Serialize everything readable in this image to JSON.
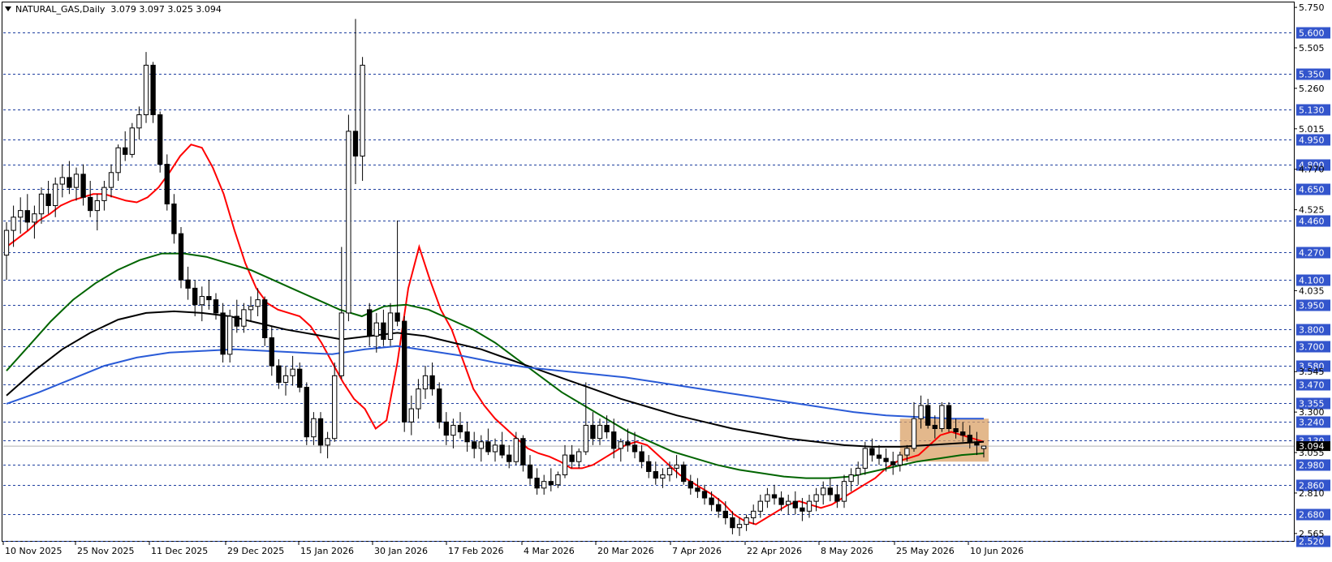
{
  "header": {
    "symbol_timeframe": "NATURAL_GAS,Daily",
    "ohlc": "3.079 3.097 3.025 3.094"
  },
  "colors": {
    "level_line": "#1f3f9f",
    "level_label_bg": "#3355cc",
    "ma_red": "#ff0000",
    "ma_green": "#006400",
    "ma_black": "#000000",
    "ma_blue": "#2a5bd7",
    "candle_bull": "#ffffff",
    "candle_bear": "#000000",
    "highlight_box": "#d9a066"
  },
  "price_axis": {
    "ticks": [
      "5.750",
      "5.505",
      "5.260",
      "5.015",
      "4.770",
      "4.525",
      "4.035",
      "3.545",
      "3.300",
      "3.055",
      "2.810",
      "2.565"
    ],
    "current_price": "3.094"
  },
  "levels": [
    "5.600",
    "5.350",
    "5.130",
    "4.950",
    "4.800",
    "4.650",
    "4.460",
    "4.270",
    "4.100",
    "3.950",
    "3.800",
    "3.700",
    "3.580",
    "3.470",
    "3.355",
    "3.240",
    "3.130",
    "2.980",
    "2.860",
    "2.680",
    "2.520"
  ],
  "time_axis": [
    "10 Nov 2025",
    "25 Nov 2025",
    "11 Dec 2025",
    "29 Dec 2025",
    "15 Jan 2026",
    "30 Jan 2026",
    "17 Feb 2026",
    "4 Mar 2026",
    "20 Mar 2026",
    "7 Apr 2026",
    "22 Apr 2026",
    "8 May 2026",
    "25 May 2026",
    "10 Jun 2026"
  ],
  "highlight_zone": {
    "from": "25 May 2026",
    "to": "10 Jun 2026",
    "high": 3.26,
    "low": 3.0
  },
  "chart_data": {
    "type": "candlestick",
    "price_min": 2.52,
    "price_max": 5.78,
    "candles": [
      {
        "o": 4.25,
        "h": 4.45,
        "l": 4.1,
        "c": 4.4
      },
      {
        "o": 4.4,
        "h": 4.55,
        "l": 4.3,
        "c": 4.48
      },
      {
        "o": 4.48,
        "h": 4.6,
        "l": 4.38,
        "c": 4.52
      },
      {
        "o": 4.52,
        "h": 4.62,
        "l": 4.4,
        "c": 4.45
      },
      {
        "o": 4.45,
        "h": 4.55,
        "l": 4.35,
        "c": 4.5
      },
      {
        "o": 4.5,
        "h": 4.66,
        "l": 4.44,
        "c": 4.62
      },
      {
        "o": 4.62,
        "h": 4.7,
        "l": 4.5,
        "c": 4.55
      },
      {
        "o": 4.55,
        "h": 4.72,
        "l": 4.48,
        "c": 4.68
      },
      {
        "o": 4.68,
        "h": 4.8,
        "l": 4.6,
        "c": 4.72
      },
      {
        "o": 4.72,
        "h": 4.82,
        "l": 4.62,
        "c": 4.66
      },
      {
        "o": 4.66,
        "h": 4.78,
        "l": 4.58,
        "c": 4.74
      },
      {
        "o": 4.74,
        "h": 4.8,
        "l": 4.55,
        "c": 4.6
      },
      {
        "o": 4.6,
        "h": 4.7,
        "l": 4.48,
        "c": 4.52
      },
      {
        "o": 4.52,
        "h": 4.62,
        "l": 4.4,
        "c": 4.58
      },
      {
        "o": 4.58,
        "h": 4.7,
        "l": 4.52,
        "c": 4.66
      },
      {
        "o": 4.66,
        "h": 4.8,
        "l": 4.6,
        "c": 4.75
      },
      {
        "o": 4.75,
        "h": 4.92,
        "l": 4.7,
        "c": 4.9
      },
      {
        "o": 4.9,
        "h": 5.0,
        "l": 4.82,
        "c": 4.86
      },
      {
        "o": 4.86,
        "h": 5.05,
        "l": 4.84,
        "c": 5.02
      },
      {
        "o": 5.02,
        "h": 5.15,
        "l": 4.95,
        "c": 5.1
      },
      {
        "o": 5.1,
        "h": 5.48,
        "l": 5.05,
        "c": 5.4
      },
      {
        "o": 5.4,
        "h": 5.42,
        "l": 5.05,
        "c": 5.1
      },
      {
        "o": 5.1,
        "h": 5.12,
        "l": 4.75,
        "c": 4.8
      },
      {
        "o": 4.8,
        "h": 4.86,
        "l": 4.52,
        "c": 4.56
      },
      {
        "o": 4.56,
        "h": 4.62,
        "l": 4.32,
        "c": 4.38
      },
      {
        "o": 4.38,
        "h": 4.42,
        "l": 4.05,
        "c": 4.1
      },
      {
        "o": 4.1,
        "h": 4.18,
        "l": 3.98,
        "c": 4.05
      },
      {
        "o": 4.05,
        "h": 4.1,
        "l": 3.88,
        "c": 3.95
      },
      {
        "o": 3.95,
        "h": 4.06,
        "l": 3.85,
        "c": 4.0
      },
      {
        "o": 4.0,
        "h": 4.1,
        "l": 3.92,
        "c": 3.98
      },
      {
        "o": 3.98,
        "h": 4.02,
        "l": 3.86,
        "c": 3.9
      },
      {
        "o": 3.9,
        "h": 3.96,
        "l": 3.6,
        "c": 3.65
      },
      {
        "o": 3.65,
        "h": 3.92,
        "l": 3.6,
        "c": 3.88
      },
      {
        "o": 3.88,
        "h": 3.98,
        "l": 3.78,
        "c": 3.82
      },
      {
        "o": 3.82,
        "h": 3.96,
        "l": 3.78,
        "c": 3.92
      },
      {
        "o": 3.92,
        "h": 4.0,
        "l": 3.85,
        "c": 3.94
      },
      {
        "o": 3.94,
        "h": 4.05,
        "l": 3.88,
        "c": 3.98
      },
      {
        "o": 3.98,
        "h": 4.0,
        "l": 3.7,
        "c": 3.75
      },
      {
        "o": 3.75,
        "h": 3.82,
        "l": 3.52,
        "c": 3.58
      },
      {
        "o": 3.58,
        "h": 3.62,
        "l": 3.44,
        "c": 3.48
      },
      {
        "o": 3.48,
        "h": 3.58,
        "l": 3.4,
        "c": 3.52
      },
      {
        "o": 3.52,
        "h": 3.64,
        "l": 3.46,
        "c": 3.56
      },
      {
        "o": 3.56,
        "h": 3.6,
        "l": 3.42,
        "c": 3.45
      },
      {
        "o": 3.45,
        "h": 3.48,
        "l": 3.1,
        "c": 3.15
      },
      {
        "o": 3.15,
        "h": 3.3,
        "l": 3.1,
        "c": 3.26
      },
      {
        "o": 3.26,
        "h": 3.3,
        "l": 3.05,
        "c": 3.1
      },
      {
        "o": 3.1,
        "h": 3.18,
        "l": 3.02,
        "c": 3.14
      },
      {
        "o": 3.14,
        "h": 3.6,
        "l": 3.12,
        "c": 3.52
      },
      {
        "o": 3.52,
        "h": 4.3,
        "l": 3.5,
        "c": 3.9
      },
      {
        "o": 3.9,
        "h": 5.1,
        "l": 3.85,
        "c": 5.0
      },
      {
        "o": 5.0,
        "h": 5.68,
        "l": 4.68,
        "c": 4.85
      },
      {
        "o": 4.85,
        "h": 5.45,
        "l": 4.7,
        "c": 5.4
      },
      {
        "o": 3.92,
        "h": 3.96,
        "l": 3.7,
        "c": 3.76
      },
      {
        "o": 3.76,
        "h": 3.9,
        "l": 3.66,
        "c": 3.84
      },
      {
        "o": 3.84,
        "h": 3.92,
        "l": 3.7,
        "c": 3.74
      },
      {
        "o": 3.74,
        "h": 3.96,
        "l": 3.7,
        "c": 3.9
      },
      {
        "o": 3.9,
        "h": 4.46,
        "l": 3.82,
        "c": 3.85
      },
      {
        "o": 3.85,
        "h": 3.88,
        "l": 3.18,
        "c": 3.24
      },
      {
        "o": 3.24,
        "h": 3.4,
        "l": 3.16,
        "c": 3.32
      },
      {
        "o": 3.32,
        "h": 3.5,
        "l": 3.26,
        "c": 3.44
      },
      {
        "o": 3.44,
        "h": 3.58,
        "l": 3.38,
        "c": 3.52
      },
      {
        "o": 3.52,
        "h": 3.6,
        "l": 3.4,
        "c": 3.44
      },
      {
        "o": 3.44,
        "h": 3.48,
        "l": 3.2,
        "c": 3.24
      },
      {
        "o": 3.24,
        "h": 3.3,
        "l": 3.1,
        "c": 3.16
      },
      {
        "o": 3.16,
        "h": 3.26,
        "l": 3.08,
        "c": 3.22
      },
      {
        "o": 3.22,
        "h": 3.3,
        "l": 3.14,
        "c": 3.18
      },
      {
        "o": 3.18,
        "h": 3.24,
        "l": 3.06,
        "c": 3.12
      },
      {
        "o": 3.12,
        "h": 3.18,
        "l": 3.02,
        "c": 3.08
      },
      {
        "o": 3.08,
        "h": 3.16,
        "l": 3.0,
        "c": 3.12
      },
      {
        "o": 3.12,
        "h": 3.2,
        "l": 3.04,
        "c": 3.06
      },
      {
        "o": 3.06,
        "h": 3.14,
        "l": 3.0,
        "c": 3.1
      },
      {
        "o": 3.1,
        "h": 3.18,
        "l": 3.02,
        "c": 3.04
      },
      {
        "o": 3.04,
        "h": 3.1,
        "l": 2.96,
        "c": 3.0
      },
      {
        "o": 3.0,
        "h": 3.18,
        "l": 2.98,
        "c": 3.14
      },
      {
        "o": 3.14,
        "h": 3.16,
        "l": 2.94,
        "c": 2.98
      },
      {
        "o": 2.98,
        "h": 3.04,
        "l": 2.86,
        "c": 2.9
      },
      {
        "o": 2.9,
        "h": 2.96,
        "l": 2.8,
        "c": 2.84
      },
      {
        "o": 2.84,
        "h": 2.92,
        "l": 2.8,
        "c": 2.88
      },
      {
        "o": 2.88,
        "h": 2.96,
        "l": 2.82,
        "c": 2.86
      },
      {
        "o": 2.86,
        "h": 2.94,
        "l": 2.84,
        "c": 2.92
      },
      {
        "o": 2.92,
        "h": 3.1,
        "l": 2.9,
        "c": 3.04
      },
      {
        "o": 3.04,
        "h": 3.1,
        "l": 2.96,
        "c": 3.0
      },
      {
        "o": 3.0,
        "h": 3.08,
        "l": 2.96,
        "c": 3.06
      },
      {
        "o": 3.06,
        "h": 3.48,
        "l": 3.04,
        "c": 3.22
      },
      {
        "o": 3.22,
        "h": 3.3,
        "l": 3.1,
        "c": 3.14
      },
      {
        "o": 3.14,
        "h": 3.26,
        "l": 3.1,
        "c": 3.22
      },
      {
        "o": 3.22,
        "h": 3.28,
        "l": 3.14,
        "c": 3.18
      },
      {
        "o": 3.18,
        "h": 3.26,
        "l": 3.02,
        "c": 3.08
      },
      {
        "o": 3.08,
        "h": 3.14,
        "l": 3.0,
        "c": 3.12
      },
      {
        "o": 3.12,
        "h": 3.2,
        "l": 3.06,
        "c": 3.1
      },
      {
        "o": 3.1,
        "h": 3.18,
        "l": 3.02,
        "c": 3.06
      },
      {
        "o": 3.06,
        "h": 3.1,
        "l": 2.96,
        "c": 3.0
      },
      {
        "o": 3.0,
        "h": 3.04,
        "l": 2.9,
        "c": 2.94
      },
      {
        "o": 2.94,
        "h": 3.0,
        "l": 2.86,
        "c": 2.9
      },
      {
        "o": 2.9,
        "h": 2.96,
        "l": 2.84,
        "c": 2.92
      },
      {
        "o": 2.92,
        "h": 3.0,
        "l": 2.88,
        "c": 2.96
      },
      {
        "o": 2.96,
        "h": 3.04,
        "l": 2.9,
        "c": 2.98
      },
      {
        "o": 2.98,
        "h": 3.0,
        "l": 2.86,
        "c": 2.88
      },
      {
        "o": 2.88,
        "h": 2.92,
        "l": 2.8,
        "c": 2.84
      },
      {
        "o": 2.84,
        "h": 2.9,
        "l": 2.78,
        "c": 2.82
      },
      {
        "o": 2.82,
        "h": 2.86,
        "l": 2.74,
        "c": 2.78
      },
      {
        "o": 2.78,
        "h": 2.82,
        "l": 2.7,
        "c": 2.74
      },
      {
        "o": 2.74,
        "h": 2.78,
        "l": 2.66,
        "c": 2.7
      },
      {
        "o": 2.7,
        "h": 2.76,
        "l": 2.62,
        "c": 2.66
      },
      {
        "o": 2.66,
        "h": 2.7,
        "l": 2.56,
        "c": 2.6
      },
      {
        "o": 2.6,
        "h": 2.66,
        "l": 2.55,
        "c": 2.62
      },
      {
        "o": 2.62,
        "h": 2.68,
        "l": 2.58,
        "c": 2.66
      },
      {
        "o": 2.66,
        "h": 2.74,
        "l": 2.62,
        "c": 2.7
      },
      {
        "o": 2.7,
        "h": 2.8,
        "l": 2.66,
        "c": 2.76
      },
      {
        "o": 2.76,
        "h": 2.84,
        "l": 2.72,
        "c": 2.8
      },
      {
        "o": 2.8,
        "h": 2.86,
        "l": 2.74,
        "c": 2.78
      },
      {
        "o": 2.78,
        "h": 2.82,
        "l": 2.7,
        "c": 2.74
      },
      {
        "o": 2.74,
        "h": 2.8,
        "l": 2.68,
        "c": 2.76
      },
      {
        "o": 2.76,
        "h": 2.82,
        "l": 2.68,
        "c": 2.72
      },
      {
        "o": 2.72,
        "h": 2.78,
        "l": 2.64,
        "c": 2.7
      },
      {
        "o": 2.7,
        "h": 2.8,
        "l": 2.66,
        "c": 2.76
      },
      {
        "o": 2.76,
        "h": 2.84,
        "l": 2.7,
        "c": 2.8
      },
      {
        "o": 2.8,
        "h": 2.88,
        "l": 2.74,
        "c": 2.84
      },
      {
        "o": 2.84,
        "h": 2.9,
        "l": 2.76,
        "c": 2.8
      },
      {
        "o": 2.8,
        "h": 2.86,
        "l": 2.72,
        "c": 2.76
      },
      {
        "o": 2.76,
        "h": 2.92,
        "l": 2.72,
        "c": 2.88
      },
      {
        "o": 2.88,
        "h": 2.96,
        "l": 2.82,
        "c": 2.92
      },
      {
        "o": 2.92,
        "h": 3.0,
        "l": 2.86,
        "c": 2.96
      },
      {
        "o": 2.96,
        "h": 3.12,
        "l": 2.92,
        "c": 3.08
      },
      {
        "o": 3.08,
        "h": 3.14,
        "l": 3.0,
        "c": 3.04
      },
      {
        "o": 3.04,
        "h": 3.1,
        "l": 2.98,
        "c": 3.02
      },
      {
        "o": 3.02,
        "h": 3.08,
        "l": 2.94,
        "c": 3.0
      },
      {
        "o": 3.0,
        "h": 3.06,
        "l": 2.92,
        "c": 2.98
      },
      {
        "o": 2.98,
        "h": 3.06,
        "l": 2.94,
        "c": 3.04
      },
      {
        "o": 3.04,
        "h": 3.1,
        "l": 3.0,
        "c": 3.08
      },
      {
        "o": 3.08,
        "h": 3.36,
        "l": 3.06,
        "c": 3.26
      },
      {
        "o": 3.26,
        "h": 3.4,
        "l": 3.2,
        "c": 3.34
      },
      {
        "o": 3.34,
        "h": 3.38,
        "l": 3.2,
        "c": 3.22
      },
      {
        "o": 3.22,
        "h": 3.28,
        "l": 3.14,
        "c": 3.2
      },
      {
        "o": 3.2,
        "h": 3.36,
        "l": 3.18,
        "c": 3.34
      },
      {
        "o": 3.34,
        "h": 3.36,
        "l": 3.18,
        "c": 3.2
      },
      {
        "o": 3.2,
        "h": 3.26,
        "l": 3.14,
        "c": 3.18
      },
      {
        "o": 3.18,
        "h": 3.24,
        "l": 3.12,
        "c": 3.16
      },
      {
        "o": 3.16,
        "h": 3.22,
        "l": 3.08,
        "c": 3.12
      },
      {
        "o": 3.12,
        "h": 3.18,
        "l": 3.04,
        "c": 3.1
      },
      {
        "o": 3.079,
        "h": 3.097,
        "l": 3.025,
        "c": 3.094
      }
    ],
    "series": [
      {
        "name": "",
        "color": "ma_red",
        "values": [
          4.3,
          4.35,
          4.4,
          4.46,
          4.5,
          4.55,
          4.58,
          4.6,
          4.62,
          4.62,
          4.6,
          4.58,
          4.57,
          4.6,
          4.66,
          4.75,
          4.85,
          4.92,
          4.9,
          4.78,
          4.62,
          4.4,
          4.2,
          4.05,
          3.96,
          3.92,
          3.9,
          3.88,
          3.82,
          3.72,
          3.6,
          3.48,
          3.38,
          3.32,
          3.2,
          3.25,
          3.6,
          4.05,
          4.3,
          4.1,
          3.92,
          3.8,
          3.62,
          3.44,
          3.34,
          3.26,
          3.2,
          3.14,
          3.08,
          3.05,
          3.03,
          3.0,
          2.96,
          2.96,
          2.98,
          3.02,
          3.06,
          3.1,
          3.12,
          3.1,
          3.04,
          2.98,
          2.92,
          2.88,
          2.84,
          2.8,
          2.75,
          2.68,
          2.64,
          2.62,
          2.66,
          2.7,
          2.74,
          2.76,
          2.74,
          2.72,
          2.74,
          2.78,
          2.82,
          2.86,
          2.9,
          2.96,
          3.0,
          3.02,
          3.04,
          3.1,
          3.16,
          3.18,
          3.16,
          3.14,
          3.12
        ]
      },
      {
        "name": "",
        "color": "ma_green",
        "values": [
          3.55,
          3.7,
          3.85,
          3.98,
          4.08,
          4.16,
          4.22,
          4.26,
          4.26,
          4.24,
          4.2,
          4.16,
          4.1,
          4.04,
          3.98,
          3.92,
          3.88,
          3.94,
          3.95,
          3.92,
          3.86,
          3.8,
          3.72,
          3.62,
          3.52,
          3.42,
          3.34,
          3.26,
          3.18,
          3.12,
          3.06,
          3.02,
          2.98,
          2.95,
          2.93,
          2.91,
          2.9,
          2.9,
          2.91,
          2.94,
          2.97,
          3.0,
          3.02,
          3.04,
          3.05
        ]
      },
      {
        "name": "",
        "color": "ma_black",
        "values": [
          3.4,
          3.55,
          3.68,
          3.78,
          3.86,
          3.9,
          3.91,
          3.9,
          3.88,
          3.84,
          3.8,
          3.77,
          3.74,
          3.76,
          3.78,
          3.76,
          3.72,
          3.68,
          3.62,
          3.56,
          3.5,
          3.44,
          3.38,
          3.33,
          3.28,
          3.24,
          3.2,
          3.17,
          3.14,
          3.12,
          3.1,
          3.09,
          3.09,
          3.1,
          3.11,
          3.12
        ]
      },
      {
        "name": "",
        "color": "ma_blue",
        "values": [
          3.35,
          3.42,
          3.5,
          3.58,
          3.63,
          3.66,
          3.67,
          3.68,
          3.67,
          3.66,
          3.65,
          3.68,
          3.7,
          3.67,
          3.64,
          3.6,
          3.57,
          3.55,
          3.53,
          3.51,
          3.48,
          3.45,
          3.42,
          3.39,
          3.36,
          3.33,
          3.3,
          3.28,
          3.27,
          3.26,
          3.26
        ]
      }
    ]
  }
}
